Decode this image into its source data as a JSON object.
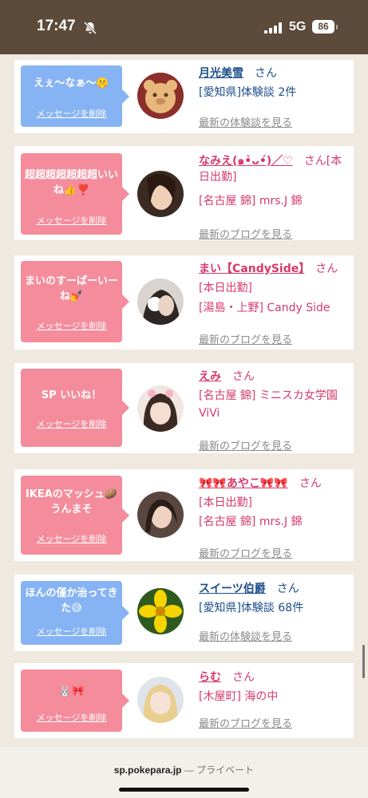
{
  "status_bar": {
    "time": "17:47",
    "network": "5G",
    "battery": "86"
  },
  "colors": {
    "status_bg": "#5c4a3a",
    "page_bg": "#efe9e0",
    "bubble_blue": "#86b3f3",
    "bubble_pink": "#f48c9c",
    "name_blue": "#1d4e8c",
    "name_pink": "#d63a6a"
  },
  "delete_label": "メッセージを削除",
  "cards": [
    {
      "message": "えぇ〜なぁ〜🤫",
      "name": "月光美雪",
      "san": "さん",
      "name_suffix": "",
      "line1": "[愛知県]体験談 2件",
      "line2": "",
      "more": "最新の体験談を見る"
    },
    {
      "message": "超超超超超超超いいね👍❣️",
      "name": "なみえ(๑•̀ᴗ•́)／♡",
      "san": "さん",
      "name_suffix": "[本日出勤]",
      "line1": "[名古屋 錦] mrs.J 錦",
      "line2": "",
      "more": "最新のブログを見る"
    },
    {
      "message": "まいのすーぱーいーね💅",
      "name": "まい【CandySide】",
      "san": "さん",
      "name_suffix": "",
      "line1": "[本日出勤]",
      "line2": "[湯島・上野] Candy Side",
      "more": "最新のブログを見る"
    },
    {
      "message": "SP いいね！",
      "name": "えみ",
      "san": "さん",
      "name_suffix": "",
      "line1": "[名古屋 錦] ミニスカ女学園",
      "line2": "ViVi",
      "more": "最新のブログを見る"
    },
    {
      "message": "IKEAのマッシュ🥔うんまそ",
      "name": "🎀🎀あやこ🎀🎀",
      "san": "さん",
      "name_suffix": "",
      "line1": "[本日出勤]",
      "line2": "[名古屋 錦] mrs.J 錦",
      "more": "最新のブログを見る"
    },
    {
      "message": "ほんの僅か治ってきた😅",
      "name": "スイーツ伯爵",
      "san": "さん",
      "name_suffix": "",
      "line1": "[愛知県]体験談 68件",
      "line2": "",
      "more": "最新の体験談を見る"
    },
    {
      "message": "🐰🎀",
      "name": "らむ",
      "san": "さん",
      "name_suffix": "",
      "line1": "[木屋町] 海の中",
      "line2": "",
      "more": "最新のブログを見る"
    }
  ],
  "browser": {
    "domain": "sp.pokepara.jp",
    "separator": " — ",
    "mode": "プライベート"
  }
}
